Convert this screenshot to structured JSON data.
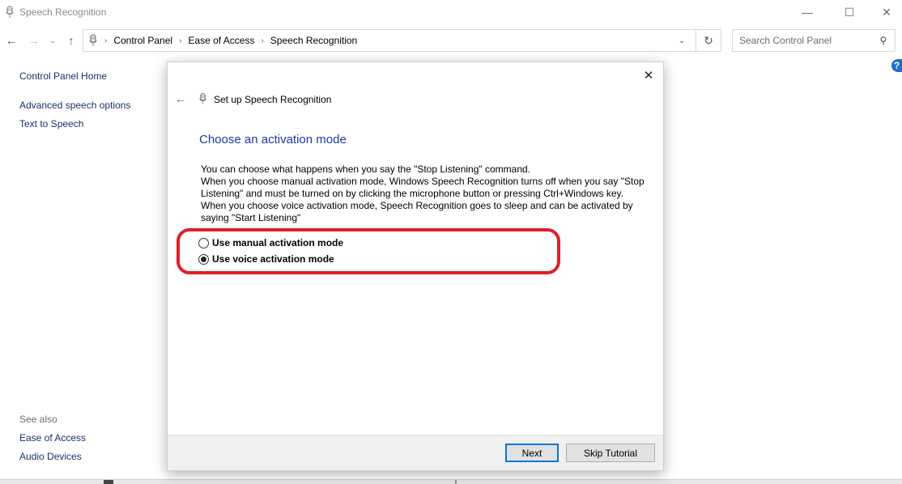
{
  "window": {
    "title": "Speech Recognition",
    "app_icon": "microphone-icon",
    "controls": {
      "minimize": "—",
      "maximize": "☐",
      "close": "✕"
    }
  },
  "navigation": {
    "back_glyph": "←",
    "forward_glyph": "→",
    "recent_glyph": "⌄",
    "up_glyph": "↑",
    "breadcrumb": [
      "Control Panel",
      "Ease of Access",
      "Speech Recognition"
    ],
    "breadcrumb_separator": "›",
    "dropdown_glyph": "⌄",
    "refresh_glyph": "↻",
    "search": {
      "placeholder": "Search Control Panel",
      "value": "",
      "icon_glyph": "⚲"
    }
  },
  "help": {
    "glyph": "?"
  },
  "sidebar": {
    "home": "Control Panel Home",
    "links": [
      "Advanced speech options",
      "Text to Speech"
    ],
    "see_also_label": "See also",
    "see_also_links": [
      "Ease of Access",
      "Audio Devices"
    ]
  },
  "dialog": {
    "title": "Set up Speech Recognition",
    "back_glyph": "←",
    "close_glyph": "✕",
    "heading": "Choose an activation mode",
    "body": [
      "You can choose what happens when you say the \"Stop Listening\" command.",
      "When you choose manual activation mode, Windows Speech Recognition turns off when you say \"Stop Listening\" and must be turned on by clicking the microphone button or pressing Ctrl+Windows key.",
      "When you choose voice activation mode, Speech Recognition goes to sleep and can be activated by saying \"Start Listening\""
    ],
    "options": [
      {
        "label": "Use manual activation mode",
        "checked": false
      },
      {
        "label": "Use voice activation mode",
        "checked": true
      }
    ],
    "buttons": {
      "next": "Next",
      "skip": "Skip Tutorial"
    },
    "highlight_color": "#e0202a"
  },
  "colors": {
    "link": "#1a2e6e",
    "heading": "#1a3c9e",
    "focus_border": "#0078d7"
  }
}
